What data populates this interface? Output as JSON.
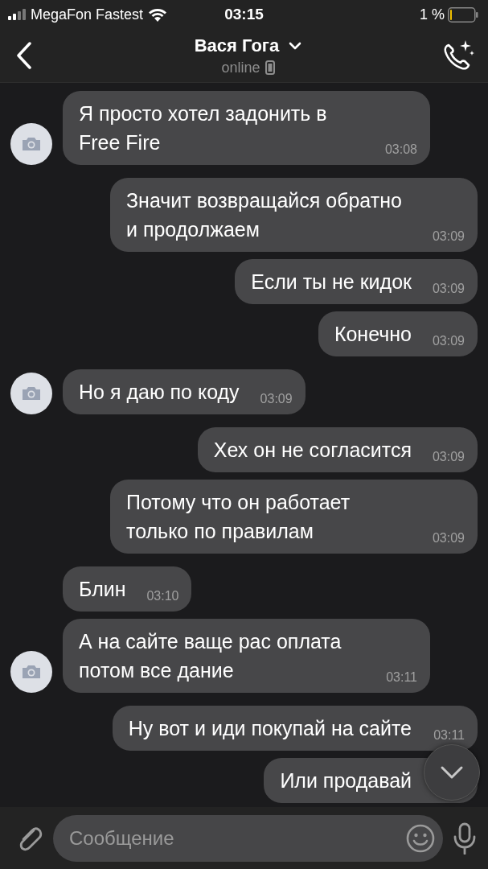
{
  "status_bar": {
    "carrier": "MegaFon Fastest",
    "time": "03:15",
    "battery": "1 %"
  },
  "header": {
    "name": "Вася Гога",
    "status": "online"
  },
  "messages": [
    {
      "kind": "incoming",
      "avatar": true,
      "text": "Я просто хотел задонить в Free Fire",
      "time": "03:08"
    },
    {
      "kind": "outgoing",
      "text": "Значит возвращайся обратно и продолжаем",
      "time": "03:09"
    },
    {
      "kind": "outgoing",
      "text": "Если ты не кидок",
      "time": "03:09"
    },
    {
      "kind": "outgoing",
      "text": "Конечно",
      "time": "03:09"
    },
    {
      "kind": "incoming",
      "avatar": true,
      "text": "Но я даю по коду",
      "time": "03:09"
    },
    {
      "kind": "outgoing",
      "text": "Хех он не согласится",
      "time": "03:09"
    },
    {
      "kind": "outgoing",
      "text": "Потому что он работает только по правилам",
      "time": "03:09"
    },
    {
      "kind": "incoming",
      "avatar": false,
      "text": "Блин",
      "time": "03:10"
    },
    {
      "kind": "incoming",
      "avatar": true,
      "text": "А на сайте ваще рас оплата потом все дание",
      "time": "03:11"
    },
    {
      "kind": "outgoing",
      "text": "Ну вот и иди покупай на сайте",
      "time": "03:11"
    },
    {
      "kind": "outgoing",
      "text": "Или продавай"
    }
  ],
  "composer": {
    "placeholder": "Сообщение"
  }
}
